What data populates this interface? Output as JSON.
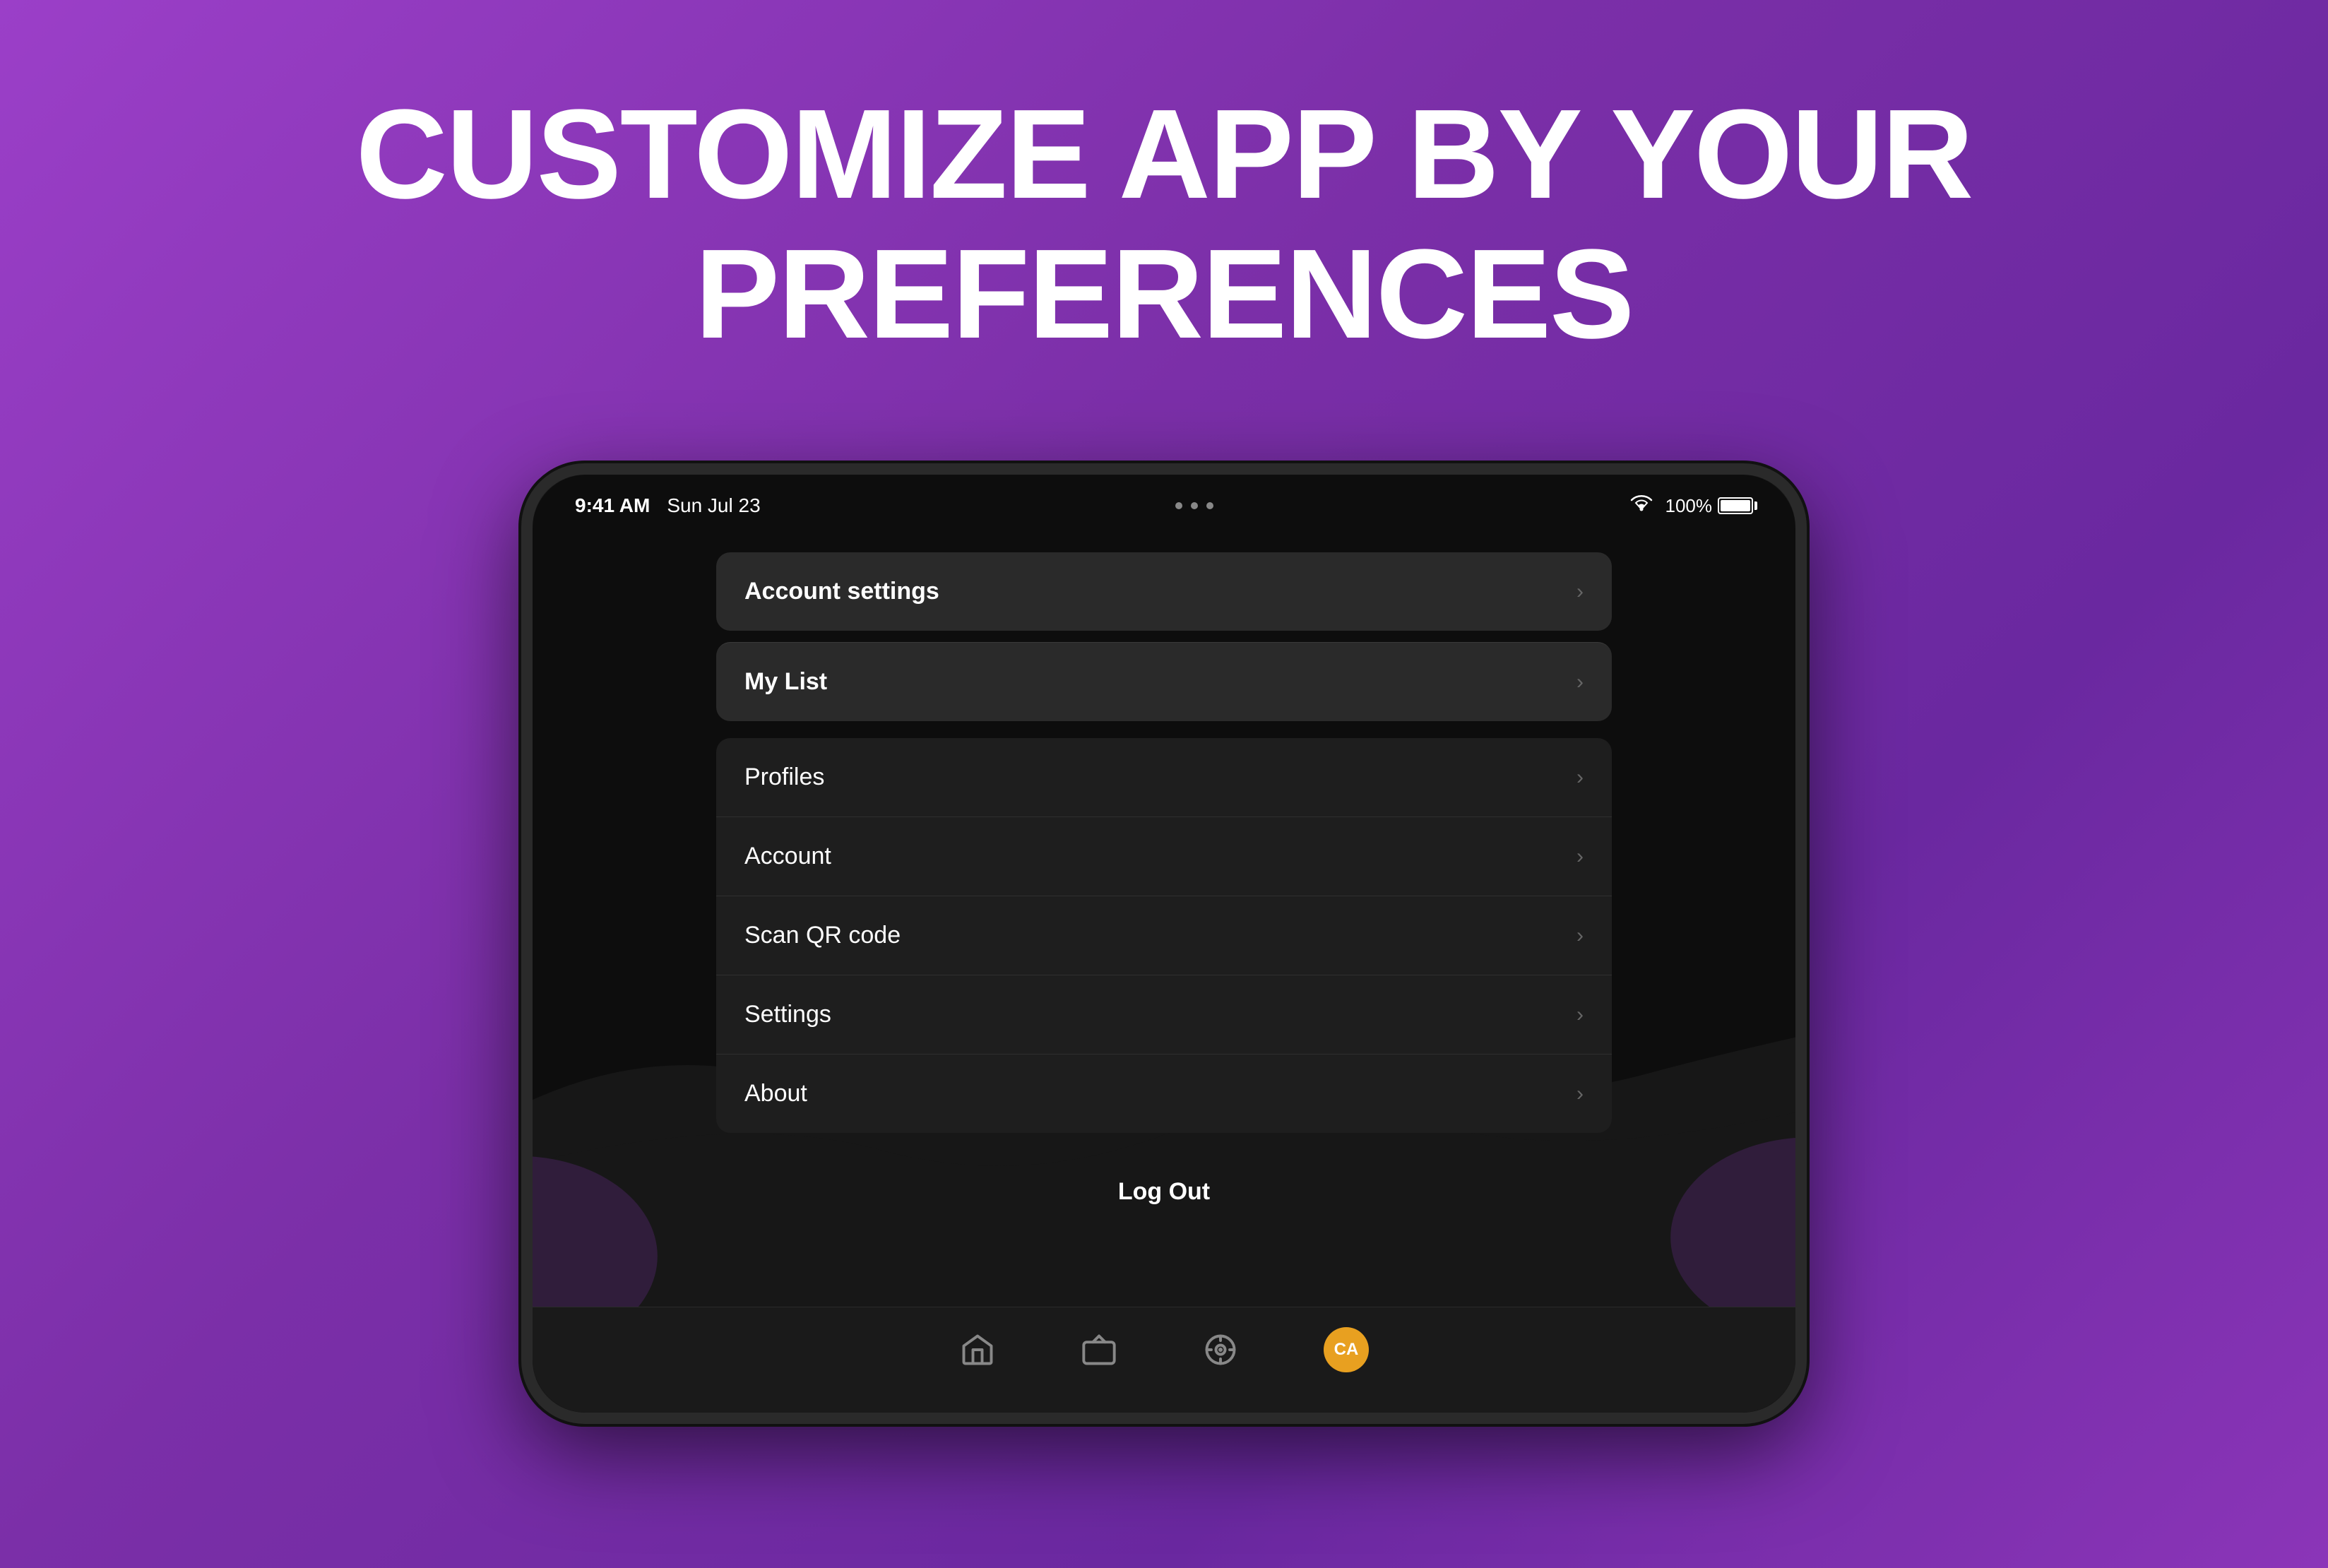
{
  "hero": {
    "title_line1": "CUSTOMIZE APP BY YOUR",
    "title_line2": "PREFERENCES"
  },
  "status_bar": {
    "time": "9:41 AM",
    "date": "Sun Jul 23",
    "battery_percent": "100%"
  },
  "menu": {
    "account_settings_label": "Account settings",
    "my_list_label": "My List",
    "section_items": [
      {
        "label": "Profiles"
      },
      {
        "label": "Account"
      },
      {
        "label": "Scan QR code"
      },
      {
        "label": "Settings"
      },
      {
        "label": "About"
      }
    ],
    "logout_label": "Log Out"
  },
  "bottom_nav": {
    "home_icon": "home",
    "tv_icon": "tv",
    "games_icon": "gamepad",
    "avatar_initials": "CA"
  }
}
